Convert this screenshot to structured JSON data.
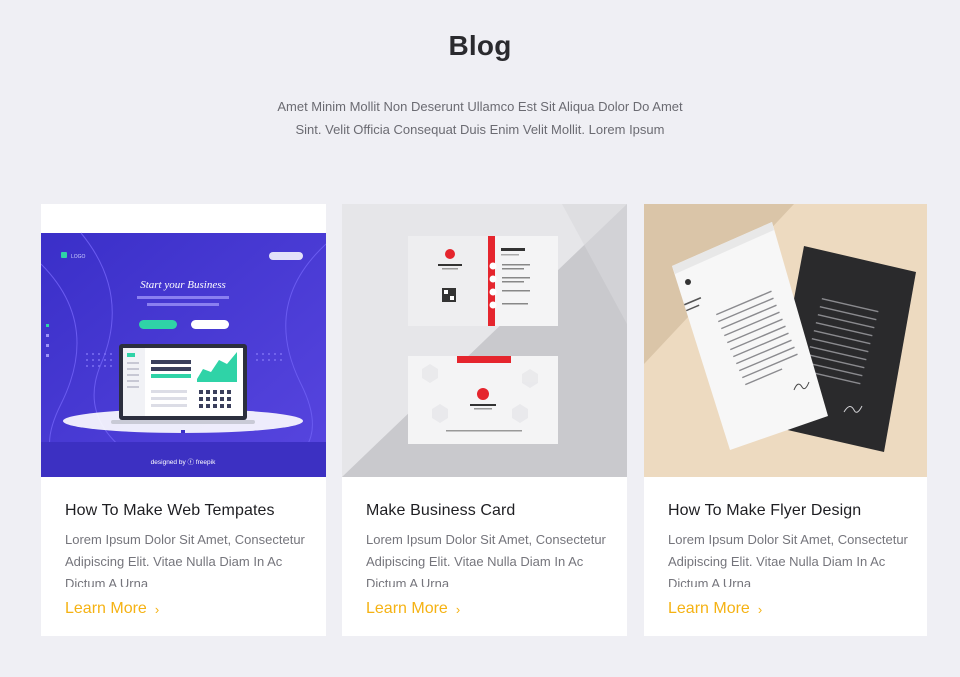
{
  "header": {
    "title": "Blog",
    "subtitle": "Amet Minim Mollit Non Deserunt Ullamco Est Sit Aliqua Dolor Do Amet Sint. Velit Officia Consequat Duis Enim Velit Mollit. Lorem Ipsum"
  },
  "cards": [
    {
      "title": "How To Make Web Tempates",
      "body": "Lorem Ipsum Dolor Sit Amet, Consectetur Adipiscing Elit. Vitae Nulla Diam In Ac Dictum A Urna",
      "link": "Learn More",
      "thumb": {
        "kind": "web-template",
        "headline": "Start your Business",
        "brand": "LOGO",
        "credit": "designed by ⓕ freepik"
      }
    },
    {
      "title": "Make Business Card",
      "body": "Lorem Ipsum Dolor Sit Amet, Consectetur Adipiscing Elit. Vitae Nulla Diam In Ac Dictum A Urna",
      "link": "Learn More",
      "thumb": {
        "kind": "business-card"
      }
    },
    {
      "title": "How To Make Flyer Design",
      "body": "Lorem Ipsum Dolor Sit Amet, Consectetur Adipiscing Elit. Vitae Nulla Diam In Ac Dictum A Urna",
      "link": "Learn More",
      "thumb": {
        "kind": "letterhead"
      }
    }
  ],
  "colors": {
    "background": "#efeff4",
    "accent": "#f5b213",
    "card": "#ffffff",
    "web_template_purple": "#4b3bd6",
    "business_card_red": "#e5252d"
  },
  "icons": {
    "link_arrow": "chevron-right-icon"
  }
}
